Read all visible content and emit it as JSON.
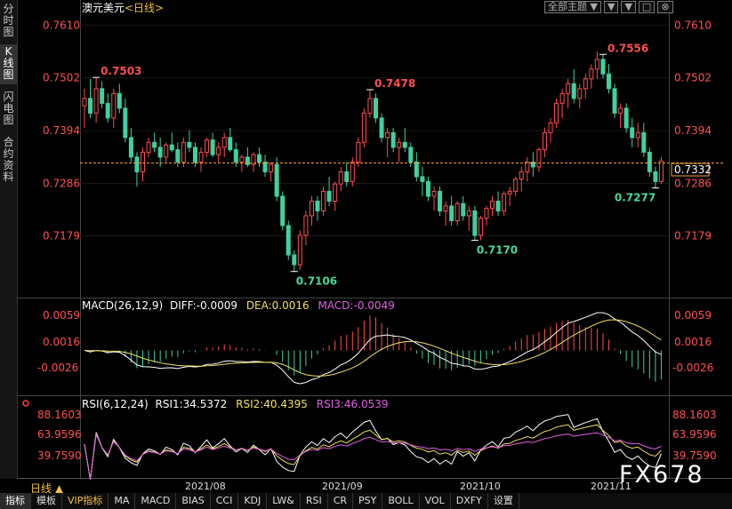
{
  "left_tabs": [
    "分时图",
    "K线图",
    "闪电图",
    "合约资料"
  ],
  "top_buttons": [
    "全部主题 ▼",
    "▼",
    "▼",
    "□",
    "⊗"
  ],
  "price_panel": {
    "title": "澳元美元",
    "period_tag": "<日线>",
    "axis_labels": [
      "0.7610",
      "0.7502",
      "0.7394",
      "0.7286",
      "0.7179"
    ],
    "current_price": "0.7332",
    "annotations": [
      {
        "text": "0.7503",
        "color": "#ff5050"
      },
      {
        "text": "0.7478",
        "color": "#ff5050"
      },
      {
        "text": "0.7556",
        "color": "#ff5050"
      },
      {
        "text": "0.7106",
        "color": "#4bd99a"
      },
      {
        "text": "0.7170",
        "color": "#4bd99a"
      },
      {
        "text": "0.7277",
        "color": "#4bd99a"
      }
    ]
  },
  "macd_panel": {
    "title": "MACD(26,12,9)",
    "diff": "DIFF:-0.0009",
    "dea": "DEA:0.0016",
    "macd": "MACD:-0.0049",
    "axis_labels": [
      "0.0059",
      "0.0016",
      "-0.0026"
    ]
  },
  "rsi_panel": {
    "title": "RSI(6,12,24)",
    "rsi1": "RSI1:34.5372",
    "rsi2": "RSI2:40.4395",
    "rsi3": "RSI3:46.0539",
    "axis_labels": [
      "88.1603",
      "63.9596",
      "39.7590"
    ]
  },
  "date_labels": [
    "2021/08",
    "2021/09",
    "2021/10",
    "2021/11"
  ],
  "period_button": "日线 ▲",
  "bottom_tabs": [
    "指标",
    "模板",
    "VIP指标",
    "MA",
    "MACD",
    "BIAS",
    "CCI",
    "KDJ",
    "LW&",
    "RSI",
    "CR",
    "PSY",
    "BOLL",
    "VOL",
    "DXFY",
    "设置"
  ],
  "watermark": "FX678",
  "colors": {
    "up": "#ff4d4d",
    "down": "#3fd1a0",
    "diff": "#ffffff",
    "dea": "#f0e060",
    "macd": "#e060e0"
  },
  "chart_data": {
    "type": "candlestick",
    "ohlc": [
      [
        0.7445,
        0.748,
        0.74,
        0.746
      ],
      [
        0.746,
        0.75,
        0.742,
        0.743
      ],
      [
        0.743,
        0.7503,
        0.741,
        0.748
      ],
      [
        0.748,
        0.7495,
        0.744,
        0.745
      ],
      [
        0.745,
        0.747,
        0.741,
        0.742
      ],
      [
        0.742,
        0.748,
        0.74,
        0.747
      ],
      [
        0.747,
        0.749,
        0.743,
        0.744
      ],
      [
        0.744,
        0.746,
        0.737,
        0.738
      ],
      [
        0.738,
        0.74,
        0.733,
        0.734
      ],
      [
        0.734,
        0.735,
        0.728,
        0.731
      ],
      [
        0.731,
        0.736,
        0.729,
        0.735
      ],
      [
        0.735,
        0.738,
        0.734,
        0.737
      ],
      [
        0.737,
        0.739,
        0.735,
        0.736
      ],
      [
        0.736,
        0.738,
        0.732,
        0.734
      ],
      [
        0.734,
        0.737,
        0.733,
        0.7365
      ],
      [
        0.7365,
        0.739,
        0.735,
        0.7355
      ],
      [
        0.7355,
        0.737,
        0.732,
        0.733
      ],
      [
        0.733,
        0.738,
        0.732,
        0.737
      ],
      [
        0.737,
        0.7395,
        0.735,
        0.736
      ],
      [
        0.736,
        0.737,
        0.732,
        0.733
      ],
      [
        0.733,
        0.736,
        0.731,
        0.735
      ],
      [
        0.735,
        0.738,
        0.734,
        0.7375
      ],
      [
        0.7375,
        0.739,
        0.734,
        0.7345
      ],
      [
        0.7345,
        0.737,
        0.733,
        0.736
      ],
      [
        0.736,
        0.739,
        0.734,
        0.738
      ],
      [
        0.738,
        0.74,
        0.735,
        0.7355
      ],
      [
        0.7355,
        0.737,
        0.732,
        0.733
      ],
      [
        0.733,
        0.7345,
        0.731,
        0.734
      ],
      [
        0.734,
        0.736,
        0.732,
        0.7325
      ],
      [
        0.7325,
        0.735,
        0.731,
        0.7345
      ],
      [
        0.7345,
        0.736,
        0.732,
        0.733
      ],
      [
        0.733,
        0.7345,
        0.73,
        0.731
      ],
      [
        0.731,
        0.733,
        0.729,
        0.7325
      ],
      [
        0.7325,
        0.734,
        0.725,
        0.726
      ],
      [
        0.726,
        0.727,
        0.719,
        0.72
      ],
      [
        0.72,
        0.721,
        0.713,
        0.714
      ],
      [
        0.714,
        0.715,
        0.7106,
        0.712
      ],
      [
        0.712,
        0.719,
        0.711,
        0.718
      ],
      [
        0.718,
        0.723,
        0.716,
        0.722
      ],
      [
        0.722,
        0.726,
        0.72,
        0.725
      ],
      [
        0.725,
        0.726,
        0.721,
        0.723
      ],
      [
        0.723,
        0.728,
        0.722,
        0.727
      ],
      [
        0.727,
        0.73,
        0.724,
        0.725
      ],
      [
        0.725,
        0.729,
        0.723,
        0.7285
      ],
      [
        0.7285,
        0.732,
        0.727,
        0.731
      ],
      [
        0.731,
        0.733,
        0.728,
        0.729
      ],
      [
        0.729,
        0.734,
        0.728,
        0.733
      ],
      [
        0.733,
        0.738,
        0.732,
        0.737
      ],
      [
        0.737,
        0.744,
        0.736,
        0.743
      ],
      [
        0.743,
        0.7478,
        0.742,
        0.746
      ],
      [
        0.746,
        0.747,
        0.741,
        0.742
      ],
      [
        0.742,
        0.743,
        0.737,
        0.738
      ],
      [
        0.738,
        0.74,
        0.734,
        0.739
      ],
      [
        0.739,
        0.74,
        0.735,
        0.736
      ],
      [
        0.736,
        0.738,
        0.733,
        0.737
      ],
      [
        0.737,
        0.74,
        0.735,
        0.736
      ],
      [
        0.736,
        0.737,
        0.732,
        0.733
      ],
      [
        0.733,
        0.735,
        0.729,
        0.73
      ],
      [
        0.73,
        0.732,
        0.726,
        0.729
      ],
      [
        0.729,
        0.73,
        0.725,
        0.726
      ],
      [
        0.726,
        0.728,
        0.723,
        0.727
      ],
      [
        0.727,
        0.728,
        0.722,
        0.723
      ],
      [
        0.723,
        0.725,
        0.72,
        0.724
      ],
      [
        0.724,
        0.726,
        0.72,
        0.721
      ],
      [
        0.721,
        0.725,
        0.72,
        0.7245
      ],
      [
        0.7245,
        0.726,
        0.721,
        0.722
      ],
      [
        0.722,
        0.724,
        0.719,
        0.723
      ],
      [
        0.723,
        0.724,
        0.717,
        0.718
      ],
      [
        0.718,
        0.722,
        0.717,
        0.7215
      ],
      [
        0.7215,
        0.724,
        0.72,
        0.7235
      ],
      [
        0.7235,
        0.726,
        0.722,
        0.725
      ],
      [
        0.725,
        0.727,
        0.722,
        0.723
      ],
      [
        0.723,
        0.727,
        0.722,
        0.7265
      ],
      [
        0.7265,
        0.728,
        0.724,
        0.727
      ],
      [
        0.727,
        0.73,
        0.726,
        0.7295
      ],
      [
        0.7295,
        0.732,
        0.727,
        0.731
      ],
      [
        0.731,
        0.734,
        0.729,
        0.733
      ],
      [
        0.733,
        0.735,
        0.73,
        0.732
      ],
      [
        0.732,
        0.736,
        0.731,
        0.7355
      ],
      [
        0.7355,
        0.74,
        0.734,
        0.739
      ],
      [
        0.739,
        0.742,
        0.737,
        0.741
      ],
      [
        0.741,
        0.746,
        0.74,
        0.745
      ],
      [
        0.745,
        0.748,
        0.742,
        0.747
      ],
      [
        0.747,
        0.75,
        0.744,
        0.749
      ],
      [
        0.749,
        0.752,
        0.745,
        0.746
      ],
      [
        0.746,
        0.749,
        0.744,
        0.748
      ],
      [
        0.748,
        0.751,
        0.746,
        0.75
      ],
      [
        0.75,
        0.753,
        0.748,
        0.752
      ],
      [
        0.752,
        0.7556,
        0.75,
        0.754
      ],
      [
        0.754,
        0.755,
        0.75,
        0.751
      ],
      [
        0.751,
        0.753,
        0.747,
        0.748
      ],
      [
        0.748,
        0.749,
        0.742,
        0.743
      ],
      [
        0.743,
        0.745,
        0.74,
        0.744
      ],
      [
        0.744,
        0.745,
        0.739,
        0.74
      ],
      [
        0.74,
        0.742,
        0.736,
        0.738
      ],
      [
        0.738,
        0.741,
        0.736,
        0.739
      ],
      [
        0.739,
        0.741,
        0.734,
        0.735
      ],
      [
        0.735,
        0.736,
        0.73,
        0.731
      ],
      [
        0.731,
        0.732,
        0.7277,
        0.729
      ],
      [
        0.729,
        0.734,
        0.7285,
        0.7332
      ]
    ],
    "last_price": 0.7332,
    "ylim": [
      0.708,
      0.7625
    ],
    "ticks": [
      0.761,
      0.7502,
      0.7394,
      0.7286,
      0.7179
    ]
  }
}
